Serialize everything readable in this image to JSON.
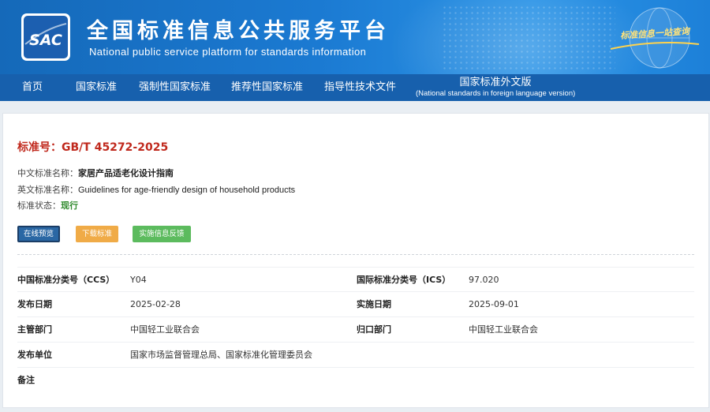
{
  "header": {
    "logo_text": "SAC",
    "title": "全国标准信息公共服务平台",
    "subtitle": "National public service platform  for standards information",
    "slogan": "标准信息一站查询"
  },
  "nav": {
    "items": [
      {
        "label": "首页"
      },
      {
        "label": "国家标准"
      },
      {
        "label": "强制性国家标准"
      },
      {
        "label": "推荐性国家标准"
      },
      {
        "label": "指导性技术文件"
      },
      {
        "label": "国家标准外文版",
        "sub": "(National standards in foreign language version)"
      }
    ]
  },
  "standard": {
    "number_label": "标准号：",
    "number": "GB/T 45272-2025",
    "cn_name_label": "中文标准名称：",
    "cn_name": "家居产品适老化设计指南",
    "en_name_label": "英文标准名称：",
    "en_name": "Guidelines for age-friendly design of household products",
    "status_label": "标准状态：",
    "status": "现行"
  },
  "buttons": {
    "preview": "在线预览",
    "download": "下载标准",
    "feedback": "实施信息反馈"
  },
  "details": [
    {
      "k1": "中国标准分类号（CCS）",
      "v1": "Y04",
      "k2": "国际标准分类号（ICS）",
      "v2": "97.020"
    },
    {
      "k1": "发布日期",
      "v1": "2025-02-28",
      "k2": "实施日期",
      "v2": "2025-09-01"
    },
    {
      "k1": "主管部门",
      "v1": "中国轻工业联合会",
      "k2": "归口部门",
      "v2": "中国轻工业联合会"
    },
    {
      "k1": "发布单位",
      "v1": "国家市场监督管理总局、国家标准化管理委员会",
      "k2": "",
      "v2": ""
    },
    {
      "k1": "备注",
      "v1": "",
      "k2": "",
      "v2": ""
    }
  ],
  "colors": {
    "banner": "#1b7ad2",
    "nav": "#1760ad",
    "std_no": "#c0291d",
    "status_green": "#2f8a2c",
    "btn_preview": "#2a67a4",
    "btn_download": "#f0ab47",
    "btn_feedback": "#5cbb5e"
  }
}
